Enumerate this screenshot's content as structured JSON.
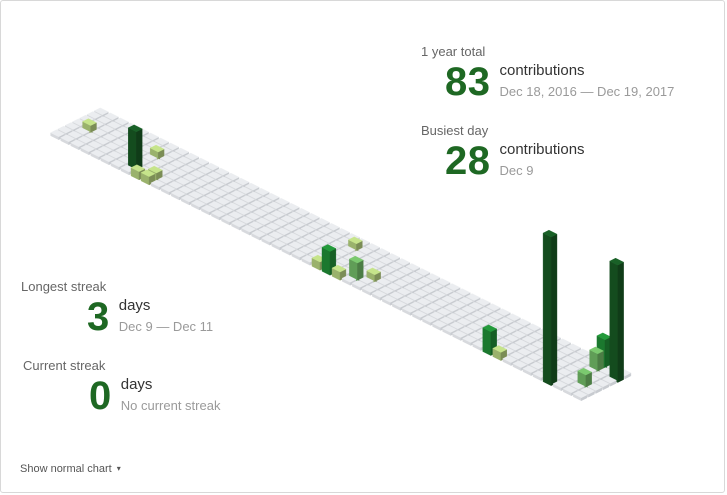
{
  "stats": {
    "year_total": {
      "label": "1 year total",
      "value": "83",
      "unit": "contributions",
      "range": "Dec 18, 2016 — Dec 19, 2017"
    },
    "busiest_day": {
      "label": "Busiest day",
      "value": "28",
      "unit": "contributions",
      "date": "Dec 9"
    },
    "longest_streak": {
      "label": "Longest streak",
      "value": "3",
      "unit": "days",
      "range": "Dec 9 — Dec 11"
    },
    "current_streak": {
      "label": "Current streak",
      "value": "0",
      "unit": "days",
      "note": "No current streak"
    }
  },
  "toggle": {
    "label": "Show normal chart",
    "caret": "▾"
  },
  "colors": {
    "empty": "#ebedf0",
    "level1": "#c6e48b",
    "level2": "#7bc96f",
    "level3": "#239a3b",
    "level4": "#196127",
    "accent": "#1e6823"
  },
  "chart_data": {
    "type": "heatmap",
    "weeks": 53,
    "days_per_week": 7,
    "cells": [
      {
        "week": 1,
        "day": 3,
        "count": 1
      },
      {
        "week": 7,
        "day": 2,
        "count": 1
      },
      {
        "week": 7,
        "day": 5,
        "count": 7
      },
      {
        "week": 8,
        "day": 6,
        "count": 1
      },
      {
        "week": 9,
        "day": 5,
        "count": 1
      },
      {
        "week": 9,
        "day": 6,
        "count": 1
      },
      {
        "week": 26,
        "day": 1,
        "count": 1
      },
      {
        "week": 26,
        "day": 6,
        "count": 1
      },
      {
        "week": 27,
        "day": 6,
        "count": 4
      },
      {
        "week": 28,
        "day": 6,
        "count": 1
      },
      {
        "week": 29,
        "day": 5,
        "count": 3
      },
      {
        "week": 30,
        "day": 4,
        "count": 1
      },
      {
        "week": 43,
        "day": 6,
        "count": 4
      },
      {
        "week": 44,
        "day": 6,
        "count": 1
      },
      {
        "week": 49,
        "day": 6,
        "count": 28
      },
      {
        "week": 50,
        "day": 0,
        "count": 5
      },
      {
        "week": 50,
        "day": 1,
        "count": 3
      },
      {
        "week": 51,
        "day": 4,
        "count": 2
      },
      {
        "week": 52,
        "day": 1,
        "count": 22
      }
    ]
  }
}
